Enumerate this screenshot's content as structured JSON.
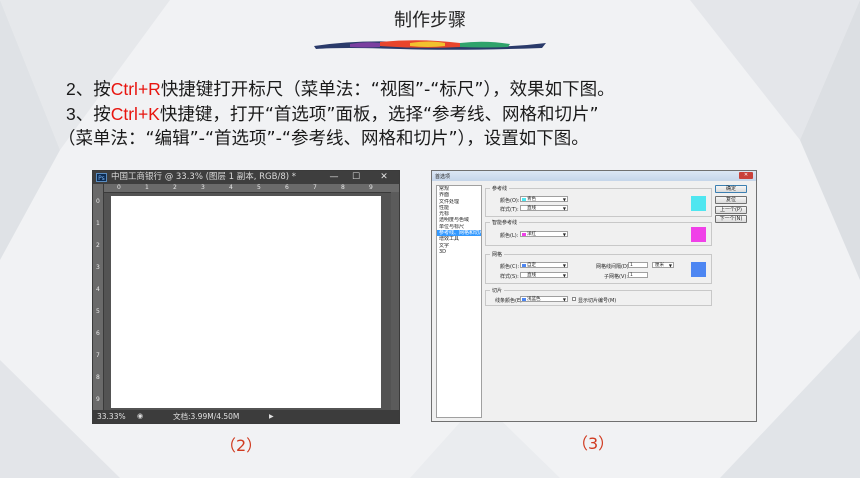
{
  "slide": {
    "title": "制作步骤",
    "step2": {
      "prefix": "2、按",
      "shortcut": "Ctrl+R",
      "rest": "快捷键打开标尺（菜单法：“视图”-“标尺”），效果如下图。"
    },
    "step3": {
      "prefix": "3、按",
      "shortcut": "Ctrl+K",
      "rest": "快捷键，打开“首选项”面板，选择“参考线、网格和切片”",
      "line2": "（菜单法：“编辑”-“首选项”-“参考线、网格和切片”），设置如下图。"
    },
    "caption_left": "（2）",
    "caption_right": "（3）"
  },
  "ps_window": {
    "logo": "Ps",
    "title": "中国工商银行 @ 33.3% (图层 1 副本, RGB/8) *",
    "minimize": "—",
    "maximize": "☐",
    "close": "✕",
    "ruler_top": [
      "0",
      "1",
      "2",
      "3",
      "4",
      "5",
      "6",
      "7",
      "8",
      "9"
    ],
    "ruler_left": [
      "0",
      "1",
      "2",
      "3",
      "4",
      "5",
      "6",
      "7",
      "8",
      "9"
    ],
    "zoom": "33.33%",
    "doc_info": "文档:3.99M/4.50M",
    "arrow": "▶"
  },
  "prefs_dialog": {
    "title": "首选项",
    "close": "✕",
    "sidebar": [
      "常规",
      "界面",
      "文件处理",
      "性能",
      "光标",
      "透明度与色域",
      "单位与标尺",
      "参考线、网格和切片",
      "增效工具",
      "文字",
      "3D"
    ],
    "selected_index": 7,
    "guides": {
      "title": "参考线",
      "color_label": "颜色(O):",
      "color_value": "青色",
      "style_label": "样式(T):",
      "style_value": "直线",
      "swatch": "#4fe6f0"
    },
    "smart_guides": {
      "title": "智能参考线",
      "color_label": "颜色(L):",
      "color_value": "洋红",
      "swatch": "#f040e8"
    },
    "grid": {
      "title": "网格",
      "color_label": "颜色(C):",
      "color_value": "自定",
      "style_label": "样式(S):",
      "style_value": "直线",
      "gridline_label": "网格线间隔(D):",
      "gridline_value": "1",
      "gridline_unit": "厘米",
      "subdiv_label": "子网格(V):",
      "subdiv_value": "1",
      "swatch": "#4d86f2"
    },
    "slices": {
      "title": "切片",
      "color_label": "线条颜色(E):",
      "color_value": "浅蓝色",
      "show_numbers_label": "显示切片编号(M)",
      "swatch": "#4d86f2"
    },
    "buttons": [
      "确定",
      "复位",
      "上一个(P)",
      "下一个(N)"
    ]
  }
}
